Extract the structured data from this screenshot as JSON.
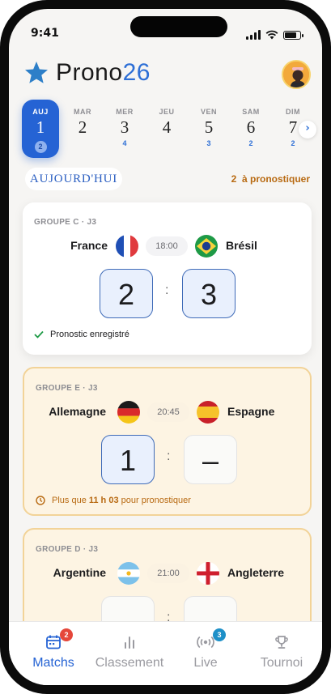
{
  "status_bar": {
    "time": "9:41"
  },
  "header": {
    "logo_main": "Prono",
    "logo_accent": "26"
  },
  "days": [
    {
      "name": "AUJ",
      "number": "1",
      "count": "2",
      "active": true
    },
    {
      "name": "MAR",
      "number": "2",
      "count": ""
    },
    {
      "name": "MER",
      "number": "3",
      "count": "4"
    },
    {
      "name": "JEU",
      "number": "4",
      "count": ""
    },
    {
      "name": "VEN",
      "number": "5",
      "count": "3"
    },
    {
      "name": "SAM",
      "number": "6",
      "count": "2"
    },
    {
      "name": "DIM",
      "number": "7",
      "count": "2"
    }
  ],
  "section": {
    "title": "AUJOURD'HUI",
    "count": "2",
    "count_label": "à pronostiquer"
  },
  "matches": [
    {
      "group": "GROUPE C · J3",
      "home": "France",
      "away": "Brésil",
      "time": "18:00",
      "home_score": "2",
      "away_score": "3",
      "footer": "Pronostic enregistré"
    },
    {
      "group": "GROUPE E · J3",
      "home": "Allemagne",
      "away": "Espagne",
      "time": "20:45",
      "home_score": "1",
      "away_score": "–",
      "footer_pre": "Plus que",
      "footer_bold": "11 h 03",
      "footer_post": "pour pronostiquer"
    },
    {
      "group": "GROUPE D · J3",
      "home": "Argentine",
      "away": "Angleterre",
      "time": "21:00",
      "home_score": "–",
      "away_score": "–"
    }
  ],
  "tabs": [
    {
      "label": "Matchs",
      "badge": "2",
      "active": true
    },
    {
      "label": "Classement"
    },
    {
      "label": "Live",
      "badge": "3"
    },
    {
      "label": "Tournoi"
    }
  ],
  "colors": {
    "accent": "#2563d4",
    "warning": "#b86a12",
    "star": "#2d7fc8"
  }
}
